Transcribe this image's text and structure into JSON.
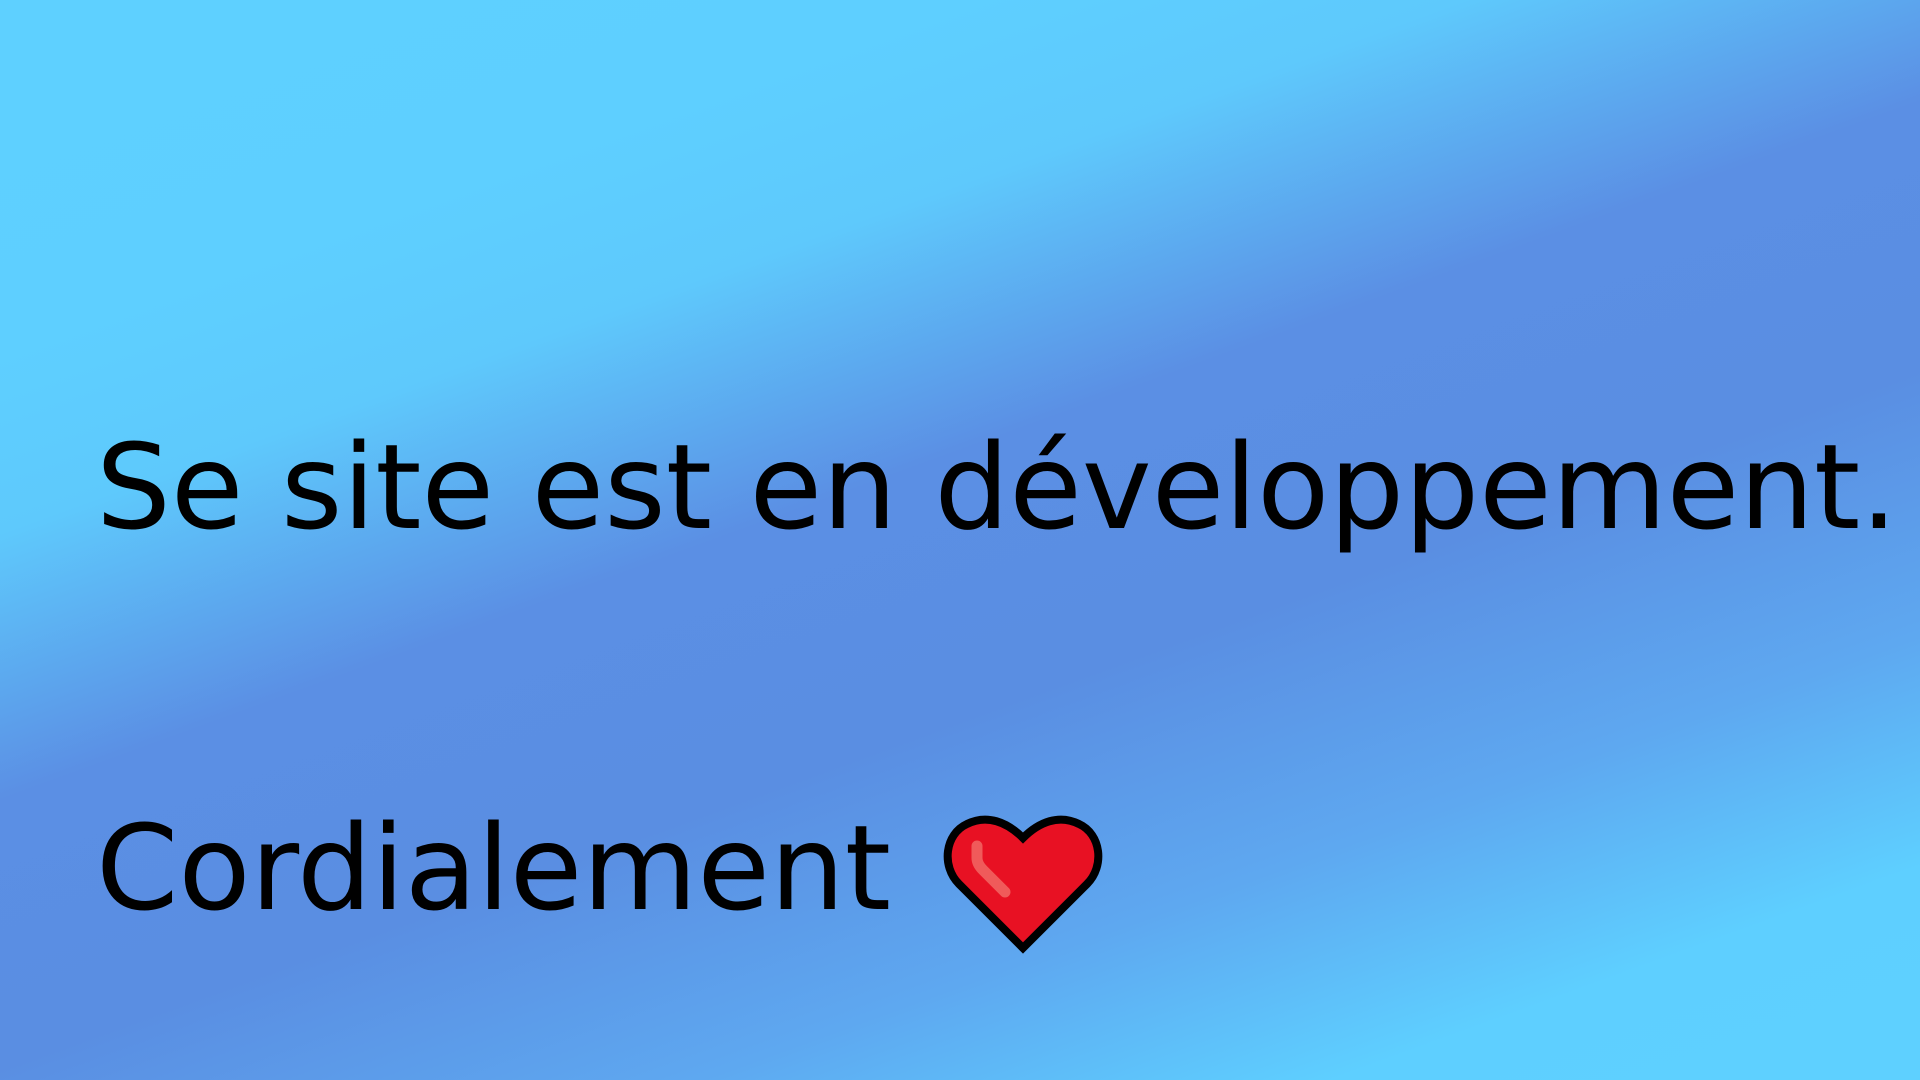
{
  "message": {
    "headline": "Se site est en développement.",
    "signoff": "Cordialement"
  },
  "icons": {
    "signoff_icon": "heart-icon"
  },
  "colors": {
    "background_light": "#5ed0ff",
    "background_dark": "#5a8ee2",
    "text": "#000000",
    "heart_fill": "#e81123",
    "heart_highlight": "#f05a5a",
    "heart_outline": "#000000"
  }
}
